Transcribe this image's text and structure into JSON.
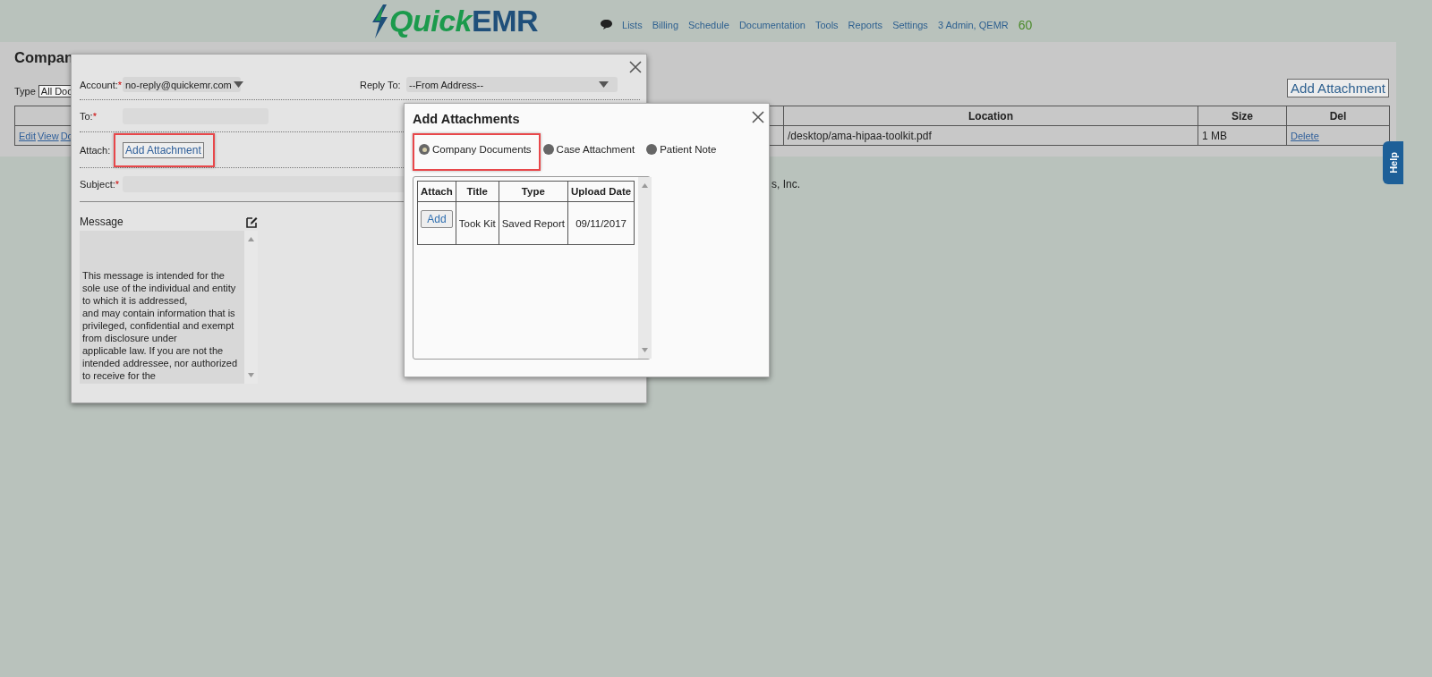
{
  "header": {
    "logo": {
      "part_1": "Quick",
      "part_2": "EMR"
    },
    "nav": [
      "Lists",
      "Billing",
      "Schedule",
      "Documentation",
      "Tools",
      "Reports",
      "Settings",
      "3 Admin, QEMR"
    ],
    "counter": "60"
  },
  "page": {
    "title": "Compan",
    "type_label": "Type",
    "type_select": "All Doc",
    "add_button": "Add Attachment",
    "table": {
      "columns": [
        "Location",
        "Size",
        "Del"
      ],
      "rows": [
        {
          "actions": [
            "Edit",
            "View",
            "Do"
          ],
          "location": "/desktop/ama-hipaa-toolkit.pdf",
          "size": "1 MB",
          "delete": "Delete"
        }
      ]
    },
    "footer": "s, Inc."
  },
  "help_tab": "Help",
  "email_dialog": {
    "account": {
      "label": "Account:",
      "mark": "*",
      "value": "no-reply@quickemr.com"
    },
    "reply_to": {
      "label": "Reply To:",
      "value": "--From Address--"
    },
    "to": {
      "label": "To:",
      "mark": "*"
    },
    "attach": {
      "label": "Attach:",
      "button": "Add Attachment",
      "highlighted": true
    },
    "subject": {
      "label": "Subject:",
      "mark": "*"
    },
    "message": {
      "label": "Message",
      "text": "This message is intended for the\nsole use of the individual and entity\nto which it is addressed,\nand may contain information that is\nprivileged, confidential and exempt\nfrom disclosure under\napplicable law. If you are not the\nintended addressee, nor authorized\nto receive for the"
    }
  },
  "attachments_dialog": {
    "title": "Add Attachments",
    "sources": [
      {
        "label": "Company Documents",
        "selected": true,
        "highlighted": true
      },
      {
        "label": "Case Attachment",
        "selected": false,
        "highlighted": false
      },
      {
        "label": "Patient Note",
        "selected": false,
        "highlighted": false
      }
    ],
    "table": {
      "columns": [
        "Attach",
        "Title",
        "Type",
        "Upload Date"
      ],
      "rows": [
        {
          "button": "Add",
          "title": "Took Kit",
          "type": "Saved Report",
          "date": "09/11/2017"
        }
      ]
    }
  }
}
